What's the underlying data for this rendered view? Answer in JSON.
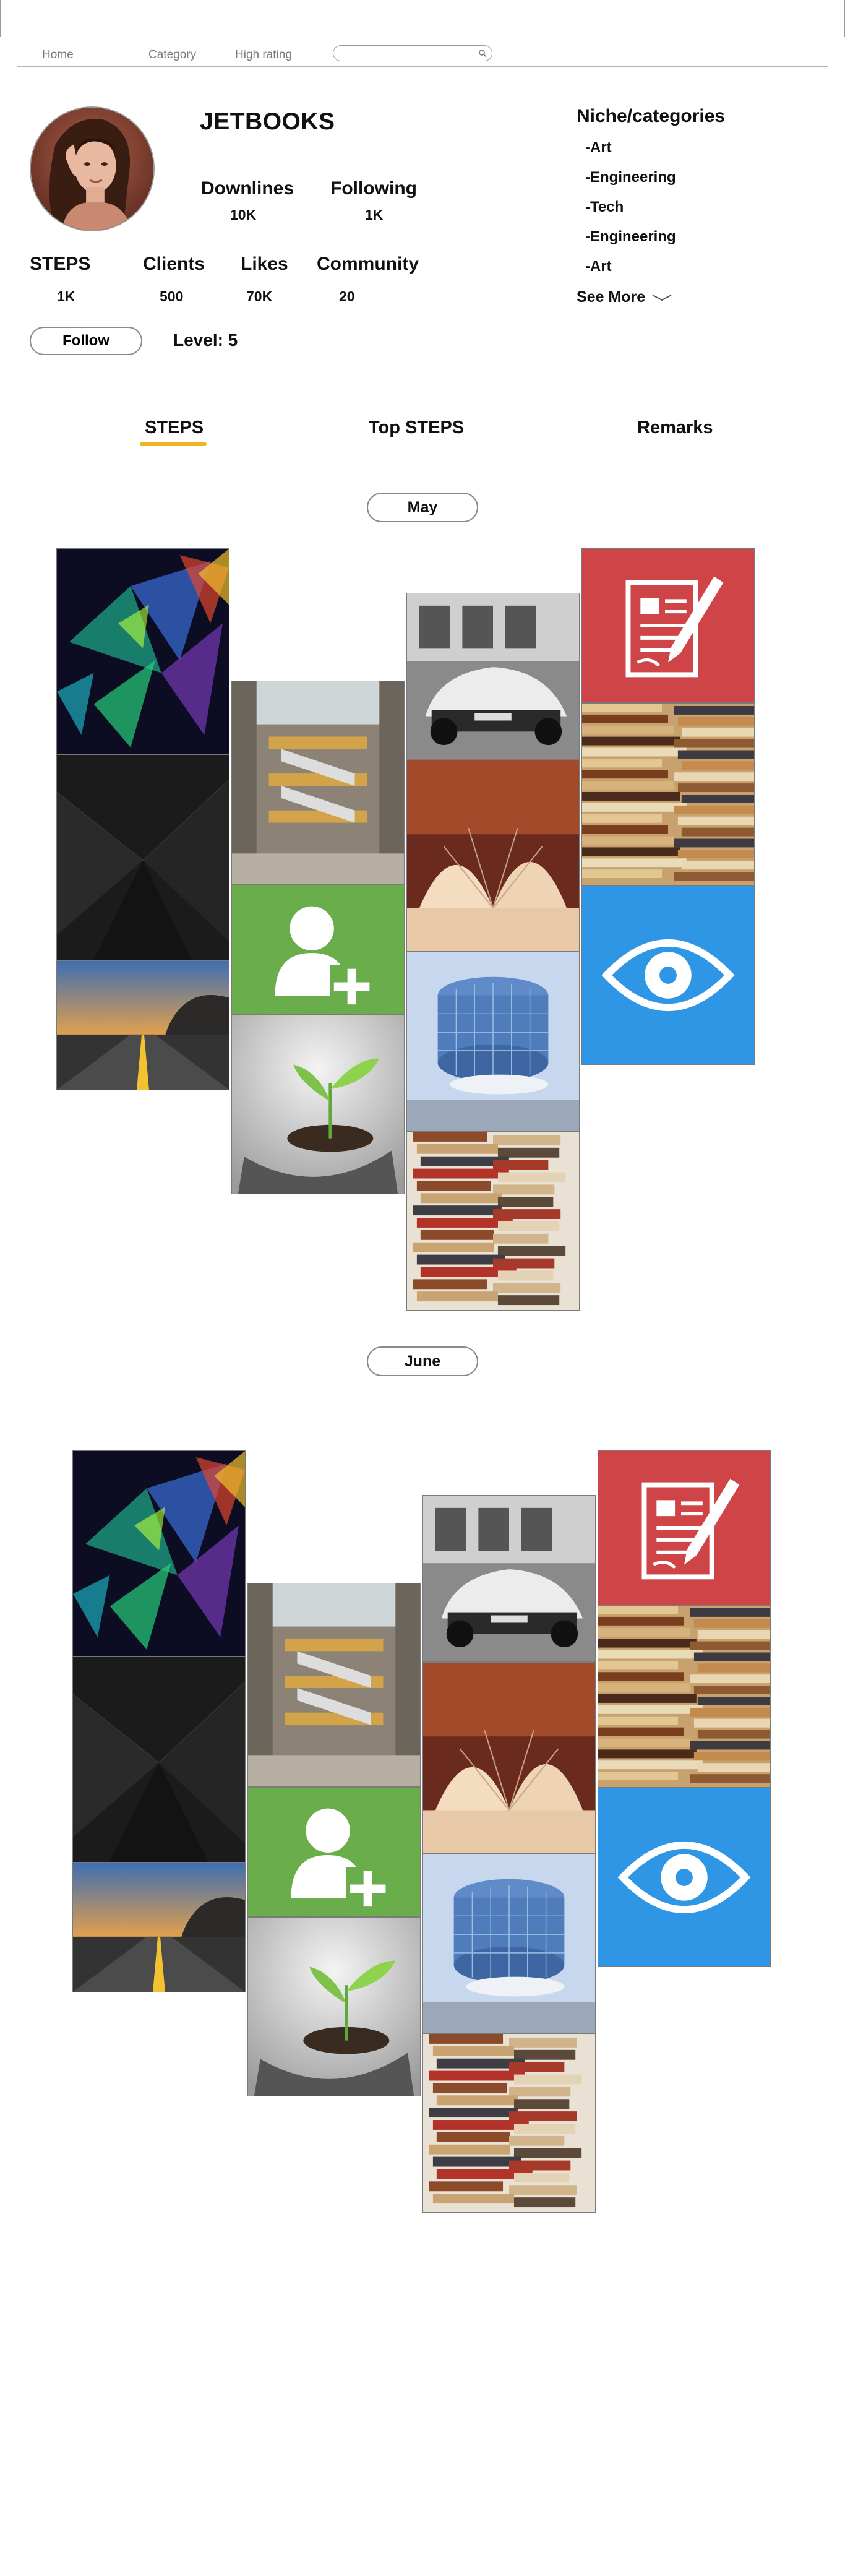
{
  "nav": {
    "items": [
      "Home",
      "Category",
      "High rating"
    ],
    "search_placeholder": ""
  },
  "profile": {
    "name": "JETBOOKS",
    "downlines_label": "Downlines",
    "downlines_value": "10K",
    "following_label": "Following",
    "following_value": "1K",
    "steps_label": "STEPS",
    "steps_value": "1K",
    "clients_label": "Clients",
    "clients_value": "500",
    "likes_label": "Likes",
    "likes_value": "70K",
    "community_label": "Community",
    "community_value": "20",
    "follow_label": "Follow",
    "level_text": "Level: 5"
  },
  "niche": {
    "title": "Niche/categories",
    "items": [
      "-Art",
      "-Engineering",
      "-Tech",
      "-Engineering",
      "-Art"
    ],
    "see_more": "See More"
  },
  "tabs": [
    "STEPS",
    "Top STEPS",
    "Remarks"
  ],
  "months": [
    "May",
    "June"
  ],
  "tile_names": [
    "abstract-polygon-image",
    "dark-concrete-image",
    "sunset-road-image",
    "mall-interior-image",
    "add-user-tile",
    "plant-in-hands-image",
    "sports-car-image",
    "open-book-image",
    "glass-building-image",
    "book-stack-image",
    "write-document-tile",
    "book-pile-image",
    "view-eye-tile"
  ],
  "colors": {
    "accent_tab_underline": "#f0b323",
    "add_user_green": "#69ae4b",
    "document_red": "#cf4446",
    "eye_blue": "#2f96e6"
  }
}
